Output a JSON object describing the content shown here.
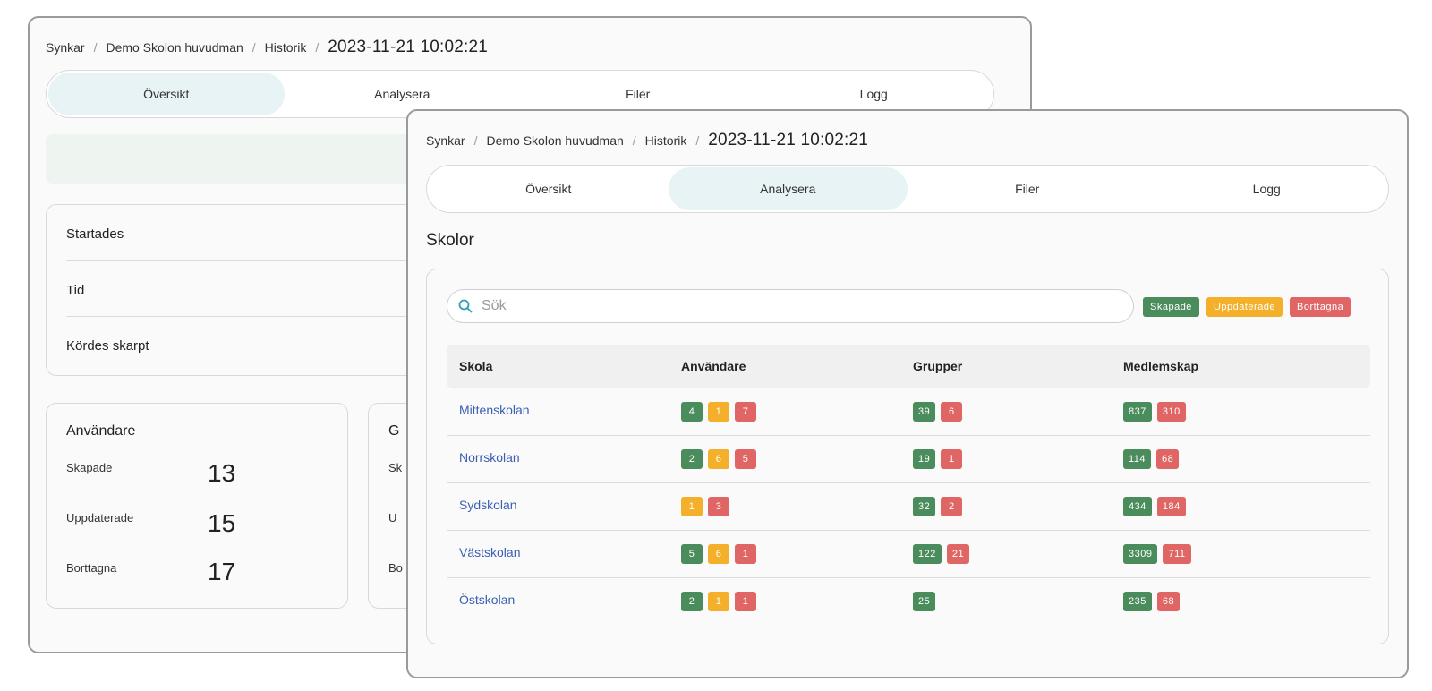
{
  "colors": {
    "created": "#4a8c5c",
    "updated": "#f4b02a",
    "deleted": "#e06666",
    "active_tab": "#e7f3f4",
    "link": "#3a5fb0"
  },
  "back": {
    "breadcrumb": {
      "items": [
        "Synkar",
        "Demo Skolon huvudman",
        "Historik"
      ],
      "timestamp": "2023-11-21 10:02:21"
    },
    "tabs": [
      "Översikt",
      "Analysera",
      "Filer",
      "Logg"
    ],
    "active_tab": 0,
    "info": [
      "Startades",
      "Tid",
      "Kördes skarpt"
    ],
    "users_card": {
      "title": "Användare",
      "rows": [
        {
          "label": "Skapade",
          "value": "13"
        },
        {
          "label": "Uppdaterade",
          "value": "15"
        },
        {
          "label": "Borttagna",
          "value": "17"
        }
      ]
    },
    "second_card": {
      "title": "G",
      "labels": [
        "Sk",
        "U",
        "Bo"
      ]
    }
  },
  "front": {
    "breadcrumb": {
      "items": [
        "Synkar",
        "Demo Skolon huvudman",
        "Historik"
      ],
      "timestamp": "2023-11-21 10:02:21"
    },
    "tabs": [
      "Översikt",
      "Analysera",
      "Filer",
      "Logg"
    ],
    "active_tab": 1,
    "section_title": "Skolor",
    "search_placeholder": "Sök",
    "legend": {
      "created": "Skapade",
      "updated": "Uppdaterade",
      "deleted": "Borttagna"
    },
    "columns": [
      "Skola",
      "Användare",
      "Grupper",
      "Medlemskap"
    ],
    "rows": [
      {
        "school": "Mittenskolan",
        "users": [
          {
            "t": "created",
            "v": "4"
          },
          {
            "t": "updated",
            "v": "1"
          },
          {
            "t": "deleted",
            "v": "7"
          }
        ],
        "groups": [
          {
            "t": "created",
            "v": "39"
          },
          {
            "t": "deleted",
            "v": "6"
          }
        ],
        "memberships": [
          {
            "t": "created",
            "v": "837"
          },
          {
            "t": "deleted",
            "v": "310"
          }
        ]
      },
      {
        "school": "Norrskolan",
        "users": [
          {
            "t": "created",
            "v": "2"
          },
          {
            "t": "updated",
            "v": "6"
          },
          {
            "t": "deleted",
            "v": "5"
          }
        ],
        "groups": [
          {
            "t": "created",
            "v": "19"
          },
          {
            "t": "deleted",
            "v": "1"
          }
        ],
        "memberships": [
          {
            "t": "created",
            "v": "114"
          },
          {
            "t": "deleted",
            "v": "68"
          }
        ]
      },
      {
        "school": "Sydskolan",
        "users": [
          {
            "t": "updated",
            "v": "1"
          },
          {
            "t": "deleted",
            "v": "3"
          }
        ],
        "groups": [
          {
            "t": "created",
            "v": "32"
          },
          {
            "t": "deleted",
            "v": "2"
          }
        ],
        "memberships": [
          {
            "t": "created",
            "v": "434"
          },
          {
            "t": "deleted",
            "v": "184"
          }
        ]
      },
      {
        "school": "Västskolan",
        "users": [
          {
            "t": "created",
            "v": "5"
          },
          {
            "t": "updated",
            "v": "6"
          },
          {
            "t": "deleted",
            "v": "1"
          }
        ],
        "groups": [
          {
            "t": "created",
            "v": "122"
          },
          {
            "t": "deleted",
            "v": "21"
          }
        ],
        "memberships": [
          {
            "t": "created",
            "v": "3309"
          },
          {
            "t": "deleted",
            "v": "711"
          }
        ]
      },
      {
        "school": "Östskolan",
        "users": [
          {
            "t": "created",
            "v": "2"
          },
          {
            "t": "updated",
            "v": "1"
          },
          {
            "t": "deleted",
            "v": "1"
          }
        ],
        "groups": [
          {
            "t": "created",
            "v": "25"
          }
        ],
        "memberships": [
          {
            "t": "created",
            "v": "235"
          },
          {
            "t": "deleted",
            "v": "68"
          }
        ]
      }
    ]
  }
}
